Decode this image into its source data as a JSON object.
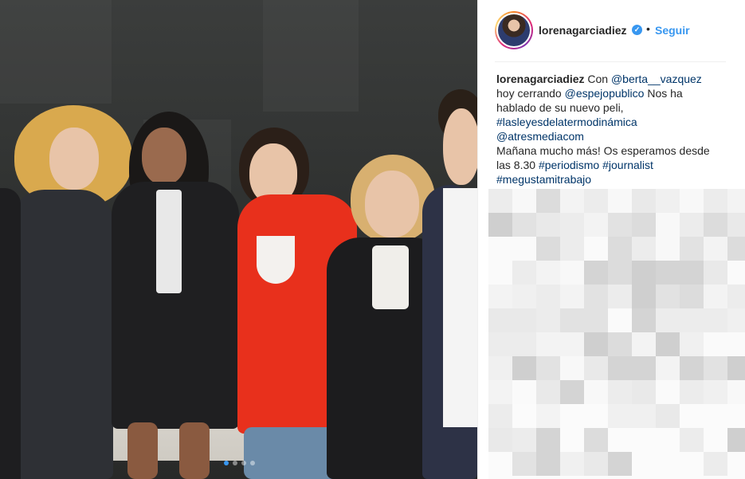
{
  "photo": {
    "carousel": {
      "count": 4,
      "active_index": 0
    }
  },
  "post": {
    "username": "lorenagarciadiez",
    "verified_icon": "verified-badge-icon",
    "separator": "•",
    "follow_label": "Seguir",
    "caption": [
      [
        {
          "t": "lorenagarciadiez",
          "k": "user"
        },
        {
          "t": " Con ",
          "k": "text"
        },
        {
          "t": "@berta__vazquez",
          "k": "link"
        }
      ],
      [
        {
          "t": "hoy cerrando ",
          "k": "text"
        },
        {
          "t": "@espejopublico",
          "k": "link"
        },
        {
          "t": " Nos ha",
          "k": "text"
        }
      ],
      [
        {
          "t": "hablado de su nuevo peli,",
          "k": "text"
        }
      ],
      [
        {
          "t": "#lasleyesdelatermodinámica",
          "k": "link"
        }
      ],
      [
        {
          "t": "@atresmediacom",
          "k": "link"
        }
      ],
      [
        {
          "t": "Mañana mucho más! Os esperamos desde",
          "k": "text"
        }
      ],
      [
        {
          "t": "las 8.30 ",
          "k": "text"
        },
        {
          "t": "#periodismo",
          "k": "link"
        },
        {
          "t": " ",
          "k": "text"
        },
        {
          "t": "#journalist",
          "k": "link"
        }
      ],
      [
        {
          "t": "#megustamitrabajo",
          "k": "link"
        }
      ]
    ]
  },
  "colors": {
    "accent": "#3897f0",
    "link": "#003569",
    "text": "#262626"
  }
}
